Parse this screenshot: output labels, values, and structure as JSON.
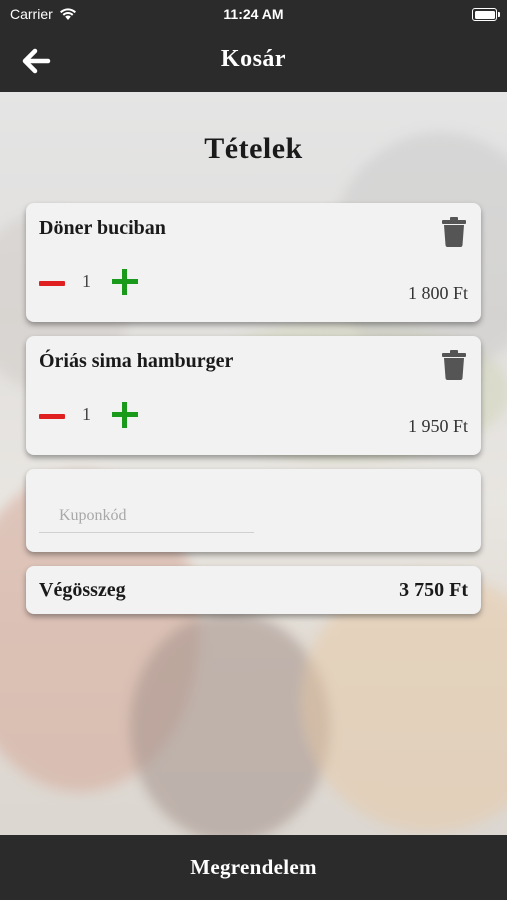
{
  "status_bar": {
    "carrier": "Carrier",
    "time": "11:24 AM"
  },
  "header": {
    "title": "Kosár",
    "back_icon": "arrow-left-icon"
  },
  "section_title": "Tételek",
  "cart_items": [
    {
      "name": "Döner buciban",
      "quantity": "1",
      "price": "1 800 Ft"
    },
    {
      "name": "Óriás sima hamburger",
      "quantity": "1",
      "price": "1 950 Ft"
    }
  ],
  "coupon": {
    "placeholder": "Kuponkód",
    "value": ""
  },
  "total": {
    "label": "Végösszeg",
    "value": "3 750 Ft"
  },
  "order_button": {
    "label": "Megrendelem"
  },
  "colors": {
    "bar": "#2b2b2b",
    "card": "#f2f2f2",
    "minus": "#e02020",
    "plus": "#1a9a1a",
    "trash": "#555555"
  }
}
